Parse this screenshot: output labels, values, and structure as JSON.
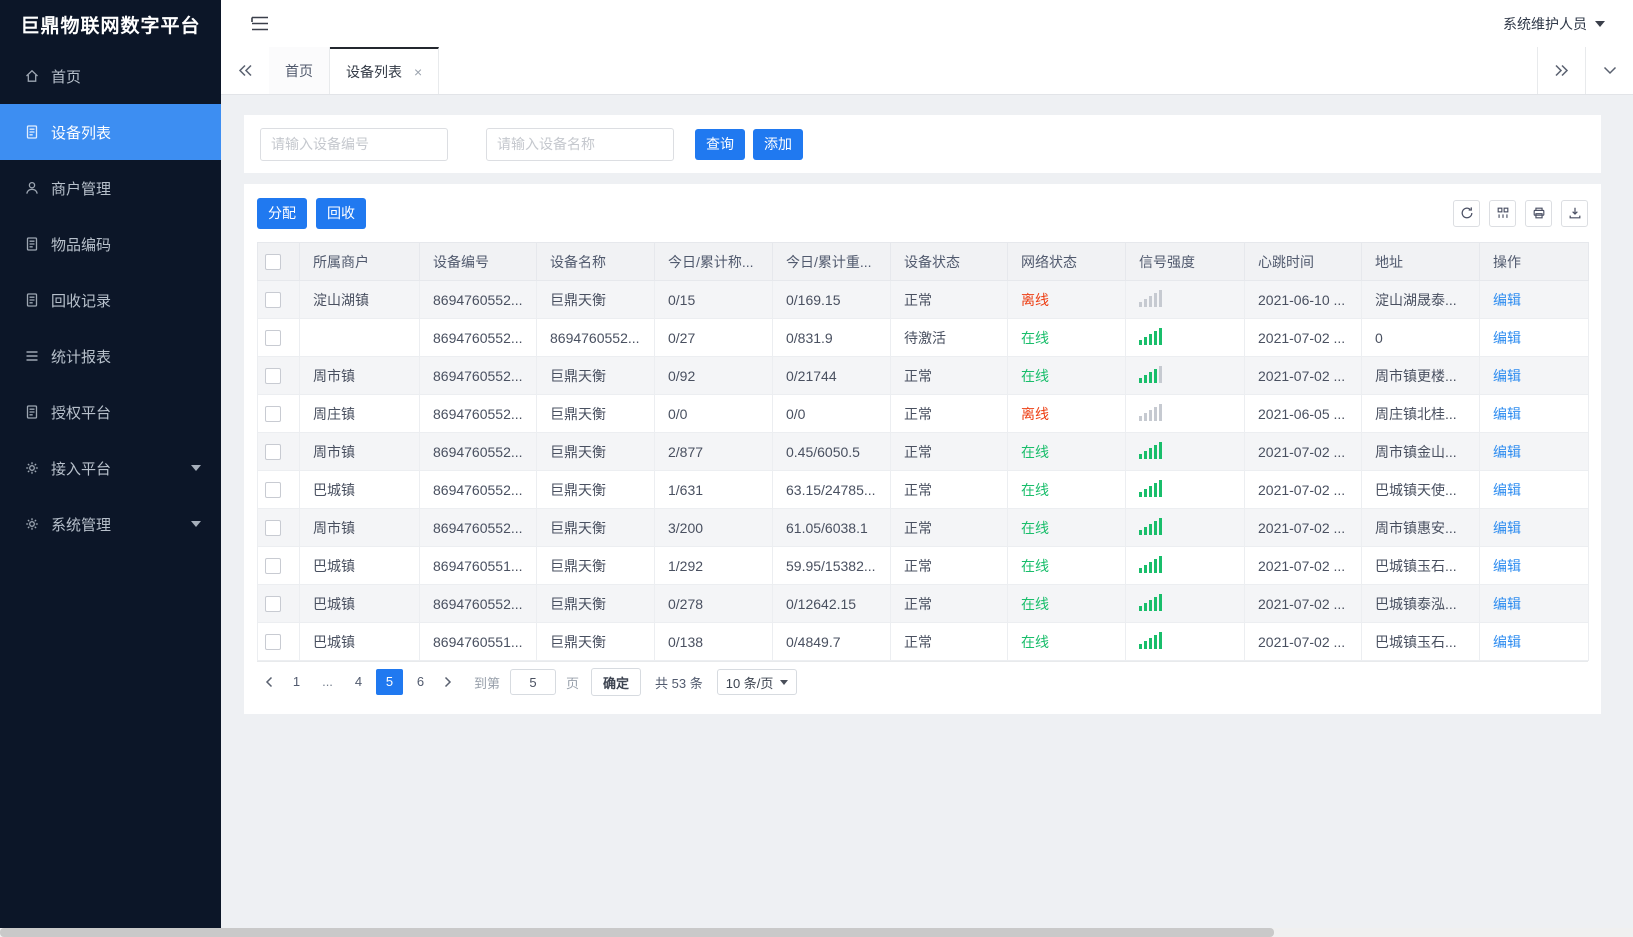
{
  "app": {
    "title": "巨鼎物联网数字平台",
    "user": "系统维护人员"
  },
  "sidebar": {
    "items": [
      {
        "label": "首页",
        "icon": "home",
        "active": false
      },
      {
        "label": "设备列表",
        "icon": "document",
        "active": true
      },
      {
        "label": "商户管理",
        "icon": "user"
      },
      {
        "label": "物品编码",
        "icon": "document"
      },
      {
        "label": "回收记录",
        "icon": "document"
      },
      {
        "label": "统计报表",
        "icon": "list"
      },
      {
        "label": "授权平台",
        "icon": "document"
      },
      {
        "label": "接入平台",
        "icon": "gear",
        "expandable": true
      },
      {
        "label": "系统管理",
        "icon": "gear",
        "expandable": true
      }
    ]
  },
  "tabs": [
    {
      "label": "首页"
    },
    {
      "label": "设备列表",
      "active": true,
      "closable": true
    }
  ],
  "search": {
    "device_no_placeholder": "请输入设备编号",
    "device_name_placeholder": "请输入设备名称",
    "query_label": "查询",
    "add_label": "添加"
  },
  "actions": {
    "assign_label": "分配",
    "recycle_label": "回收"
  },
  "table": {
    "headers": [
      {
        "label": "所属商户"
      },
      {
        "label": "设备编号"
      },
      {
        "label": "设备名称"
      },
      {
        "label": "今日/累计称..."
      },
      {
        "label": "今日/累计重..."
      },
      {
        "label": "设备状态"
      },
      {
        "label": "网络状态"
      },
      {
        "label": "信号强度"
      },
      {
        "label": "心跳时间"
      },
      {
        "label": "地址"
      },
      {
        "label": "操作"
      }
    ],
    "rows": [
      {
        "merchant": "淀山湖镇",
        "device_no": "8694760552...",
        "device_name": "巨鼎天衡",
        "today_total_count": "0/15",
        "today_total_weight": "0/169.15",
        "device_status": "正常",
        "network_status": "离线",
        "online": false,
        "signal": 0,
        "heartbeat": "2021-06-10 ...",
        "address": "淀山湖晟泰...",
        "action": "编辑"
      },
      {
        "merchant": "",
        "device_no": "8694760552...",
        "device_name": "8694760552...",
        "today_total_count": "0/27",
        "today_total_weight": "0/831.9",
        "device_status": "待激活",
        "network_status": "在线",
        "online": true,
        "signal": 5,
        "heartbeat": "2021-07-02 ...",
        "address": "0",
        "action": "编辑"
      },
      {
        "merchant": "周市镇",
        "device_no": "8694760552...",
        "device_name": "巨鼎天衡",
        "today_total_count": "0/92",
        "today_total_weight": "0/21744",
        "device_status": "正常",
        "network_status": "在线",
        "online": true,
        "signal": 4,
        "heartbeat": "2021-07-02 ...",
        "address": "周市镇更楼...",
        "action": "编辑"
      },
      {
        "merchant": "周庄镇",
        "device_no": "8694760552...",
        "device_name": "巨鼎天衡",
        "today_total_count": "0/0",
        "today_total_weight": "0/0",
        "device_status": "正常",
        "network_status": "离线",
        "online": false,
        "signal": 0,
        "heartbeat": "2021-06-05 ...",
        "address": "周庄镇北桂...",
        "action": "编辑"
      },
      {
        "merchant": "周市镇",
        "device_no": "8694760552...",
        "device_name": "巨鼎天衡",
        "today_total_count": "2/877",
        "today_total_weight": "0.45/6050.5",
        "device_status": "正常",
        "network_status": "在线",
        "online": true,
        "signal": 5,
        "heartbeat": "2021-07-02 ...",
        "address": "周市镇金山...",
        "action": "编辑"
      },
      {
        "merchant": "巴城镇",
        "device_no": "8694760552...",
        "device_name": "巨鼎天衡",
        "today_total_count": "1/631",
        "today_total_weight": "63.15/24785...",
        "device_status": "正常",
        "network_status": "在线",
        "online": true,
        "signal": 5,
        "heartbeat": "2021-07-02 ...",
        "address": "巴城镇天使...",
        "action": "编辑"
      },
      {
        "merchant": "周市镇",
        "device_no": "8694760552...",
        "device_name": "巨鼎天衡",
        "today_total_count": "3/200",
        "today_total_weight": "61.05/6038.1",
        "device_status": "正常",
        "network_status": "在线",
        "online": true,
        "signal": 5,
        "heartbeat": "2021-07-02 ...",
        "address": "周市镇惠安...",
        "action": "编辑"
      },
      {
        "merchant": "巴城镇",
        "device_no": "8694760551...",
        "device_name": "巨鼎天衡",
        "today_total_count": "1/292",
        "today_total_weight": "59.95/15382...",
        "device_status": "正常",
        "network_status": "在线",
        "online": true,
        "signal": 5,
        "heartbeat": "2021-07-02 ...",
        "address": "巴城镇玉石...",
        "action": "编辑"
      },
      {
        "merchant": "巴城镇",
        "device_no": "8694760552...",
        "device_name": "巨鼎天衡",
        "today_total_count": "0/278",
        "today_total_weight": "0/12642.15",
        "device_status": "正常",
        "network_status": "在线",
        "online": true,
        "signal": 5,
        "heartbeat": "2021-07-02 ...",
        "address": "巴城镇泰泓...",
        "action": "编辑"
      },
      {
        "merchant": "巴城镇",
        "device_no": "8694760551...",
        "device_name": "巨鼎天衡",
        "today_total_count": "0/138",
        "today_total_weight": "0/4849.7",
        "device_status": "正常",
        "network_status": "在线",
        "online": true,
        "signal": 5,
        "heartbeat": "2021-07-02 ...",
        "address": "巴城镇玉石...",
        "action": "编辑"
      }
    ]
  },
  "pagination": {
    "pages": [
      {
        "label": "1"
      },
      {
        "label": "...",
        "ellipsis": true
      },
      {
        "label": "4"
      },
      {
        "label": "5",
        "active": true
      },
      {
        "label": "6"
      }
    ],
    "goto_label": "到第",
    "goto_value": "5",
    "page_unit": "页",
    "confirm_label": "确定",
    "total_label": "共 53 条",
    "page_size": "10 条/页"
  },
  "colors": {
    "sidebar_bg": "#0c1628",
    "sidebar_active": "#3d8ef2",
    "primary_blue": "#2079f0",
    "link_blue": "#2d8cf0",
    "online_green": "#19be6b",
    "offline_red": "#ed3f14"
  }
}
